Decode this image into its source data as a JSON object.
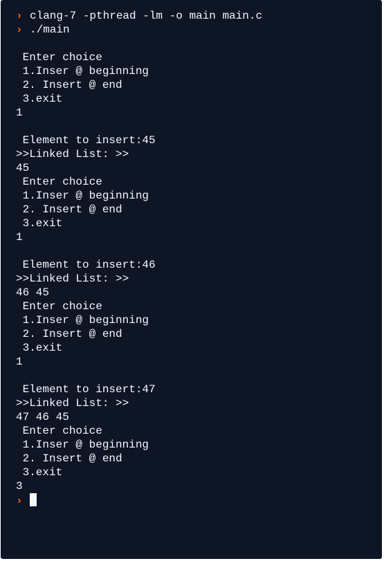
{
  "terminal": {
    "prompt_symbol": "›",
    "lines": [
      {
        "type": "command",
        "text": "clang-7 -pthread -lm -o main main.c"
      },
      {
        "type": "command",
        "text": "./main"
      },
      {
        "type": "output",
        "text": ""
      },
      {
        "type": "output",
        "text": " Enter choice"
      },
      {
        "type": "output",
        "text": " 1.Inser @ beginning"
      },
      {
        "type": "output",
        "text": " 2. Insert @ end"
      },
      {
        "type": "output",
        "text": " 3.exit"
      },
      {
        "type": "output",
        "text": "1"
      },
      {
        "type": "output",
        "text": ""
      },
      {
        "type": "output",
        "text": " Element to insert:45"
      },
      {
        "type": "output",
        "text": ">>Linked List: >>"
      },
      {
        "type": "output",
        "text": "45"
      },
      {
        "type": "output",
        "text": " Enter choice"
      },
      {
        "type": "output",
        "text": " 1.Inser @ beginning"
      },
      {
        "type": "output",
        "text": " 2. Insert @ end"
      },
      {
        "type": "output",
        "text": " 3.exit"
      },
      {
        "type": "output",
        "text": "1"
      },
      {
        "type": "output",
        "text": ""
      },
      {
        "type": "output",
        "text": " Element to insert:46"
      },
      {
        "type": "output",
        "text": ">>Linked List: >>"
      },
      {
        "type": "output",
        "text": "46 45"
      },
      {
        "type": "output",
        "text": " Enter choice"
      },
      {
        "type": "output",
        "text": " 1.Inser @ beginning"
      },
      {
        "type": "output",
        "text": " 2. Insert @ end"
      },
      {
        "type": "output",
        "text": " 3.exit"
      },
      {
        "type": "output",
        "text": "1"
      },
      {
        "type": "output",
        "text": ""
      },
      {
        "type": "output",
        "text": " Element to insert:47"
      },
      {
        "type": "output",
        "text": ">>Linked List: >>"
      },
      {
        "type": "output",
        "text": "47 46 45"
      },
      {
        "type": "output",
        "text": " Enter choice"
      },
      {
        "type": "output",
        "text": " 1.Inser @ beginning"
      },
      {
        "type": "output",
        "text": " 2. Insert @ end"
      },
      {
        "type": "output",
        "text": " 3.exit"
      },
      {
        "type": "output",
        "text": "3"
      },
      {
        "type": "input",
        "text": ""
      }
    ]
  },
  "colors": {
    "background": "#0e1525",
    "text": "#f5f9fc",
    "prompt": "#f26207"
  },
  "icons": {
    "prompt": "chevron-right-icon",
    "cursor": "block-cursor"
  }
}
